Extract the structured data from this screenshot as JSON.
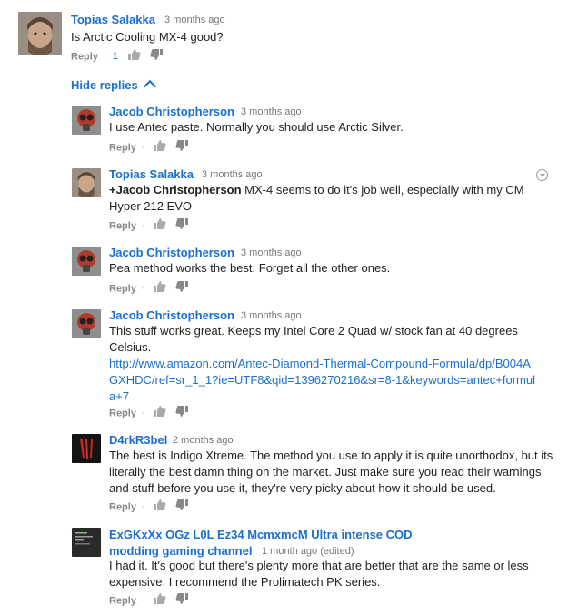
{
  "thread": {
    "hide_replies_label": "Hide replies",
    "top_comment": {
      "author": "Topias Salakka",
      "time": "3 months ago",
      "text": "Is Arctic Cooling MX-4 good?",
      "reply_label": "Reply",
      "likes": "1"
    },
    "replies": [
      {
        "author": "Jacob Christopherson",
        "time": "3 months ago",
        "text": "I use Antec paste. Normally you should use Arctic Silver.",
        "reply_label": "Reply"
      },
      {
        "author": "Topias Salakka",
        "time": "3 months ago",
        "mention": "+Jacob Christopherson",
        "text": " MX-4 seems to do it's job well, especially with my CM Hyper 212 EVO",
        "reply_label": "Reply"
      },
      {
        "author": "Jacob Christopherson",
        "time": "3 months ago",
        "text": "Pea method works the best. Forget all the other ones.",
        "reply_label": "Reply"
      },
      {
        "author": "Jacob Christopherson",
        "time": "3 months ago",
        "text": "This stuff works great. Keeps my Intel Core 2 Quad w/ stock fan at 40 degrees Celsius.",
        "link": "http://www.amazon.com/Antec-Diamond-Thermal-Compound-Formula/dp/B004AGXHDC/ref=sr_1_1?ie=UTF8&qid=1396270216&sr=8-1&keywords=antec+formula+7",
        "reply_label": "Reply"
      },
      {
        "author": "D4rkR3bel",
        "time": "2 months ago",
        "text": "The best is Indigo Xtreme. The method you use to apply it is quite unorthodox, but its literally the best damn thing on the market. Just make sure you read their warnings and stuff before you use it, they're very picky about how it should be used.",
        "reply_label": "Reply"
      },
      {
        "author": "ExGKxXx OGz L0L Ez34 McmxmcM Ultra intense COD modding gaming channel",
        "time": "1 month ago (edited)",
        "text": "I had it. It's good but there's plenty more that are better that are the same or less expensive. I recommend the Prolimatech PK series.",
        "reply_label": "Reply"
      }
    ]
  },
  "icons": {
    "like": "thumbs-up-icon",
    "dislike": "thumbs-down-icon",
    "collapse": "chevron-up-icon",
    "menu": "dropdown-menu-icon"
  }
}
